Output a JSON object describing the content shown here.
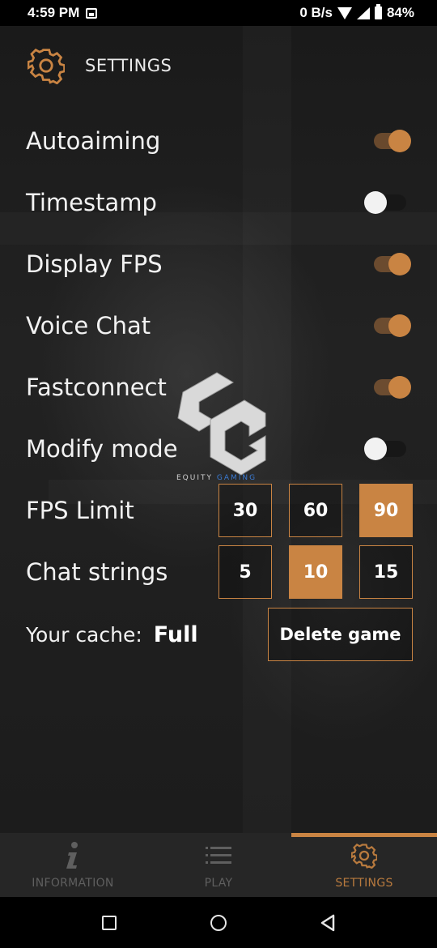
{
  "status_bar": {
    "time": "4:59 PM",
    "net_speed": "0 B/s",
    "battery": "84%"
  },
  "header": {
    "title": "SETTINGS",
    "icon": "gear-icon"
  },
  "toggles": [
    {
      "label": "Autoaiming",
      "on": true
    },
    {
      "label": "Timestamp",
      "on": false
    },
    {
      "label": "Display FPS",
      "on": true
    },
    {
      "label": "Voice Chat",
      "on": true
    },
    {
      "label": "Fastconnect",
      "on": true
    },
    {
      "label": "Modify mode",
      "on": false
    }
  ],
  "fps_limit": {
    "label": "FPS Limit",
    "options": [
      "30",
      "60",
      "90"
    ],
    "selected": "90"
  },
  "chat_strings": {
    "label": "Chat strings",
    "options": [
      "5",
      "10",
      "15"
    ],
    "selected": "10"
  },
  "cache": {
    "label": "Your cache:",
    "value": "Full",
    "delete_label": "Delete game"
  },
  "watermark": {
    "text_a": "EQUITY ",
    "text_b": "GAMING"
  },
  "bottom_nav": {
    "items": [
      {
        "label": "INFORMATION",
        "icon": "info-icon"
      },
      {
        "label": "PLAY",
        "icon": "list-icon"
      },
      {
        "label": "SETTINGS",
        "icon": "gear-icon"
      }
    ],
    "active": "SETTINGS"
  },
  "colors": {
    "accent": "#c98443",
    "background": "#1e1e1e",
    "nav_background": "#262626"
  }
}
